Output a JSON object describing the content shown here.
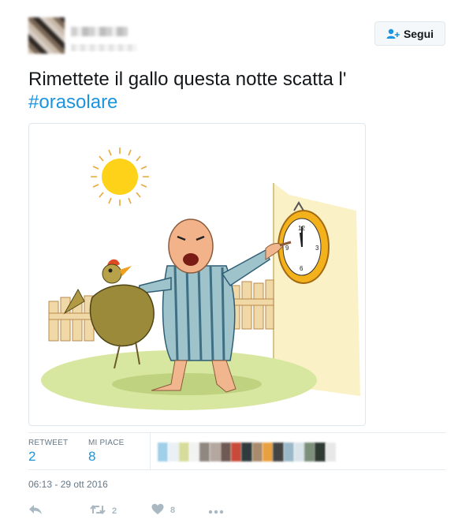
{
  "header": {
    "follow_label": "Segui",
    "icons": {
      "follow": "add-user-icon"
    }
  },
  "tweet": {
    "text": "Rimettete il gallo questa notte scatta l'",
    "hashtag": "#orasolare"
  },
  "media": {
    "alt": "cartoon illustration"
  },
  "stats": {
    "retweet_label": "RETWEET",
    "retweet_count": "2",
    "like_label": "MI PIACE",
    "like_count": "8"
  },
  "timestamp": "06:13 - 29 ott 2016",
  "actions": {
    "reply_icon": "reply-icon",
    "retweet_icon": "retweet-icon",
    "retweet_count": "2",
    "like_icon": "heart-icon",
    "like_count": "8",
    "more_icon": "more-icon"
  },
  "colors": {
    "link": "#1b95e0",
    "text": "#14171a",
    "muted": "#657786",
    "icon": "#aab8c2"
  }
}
